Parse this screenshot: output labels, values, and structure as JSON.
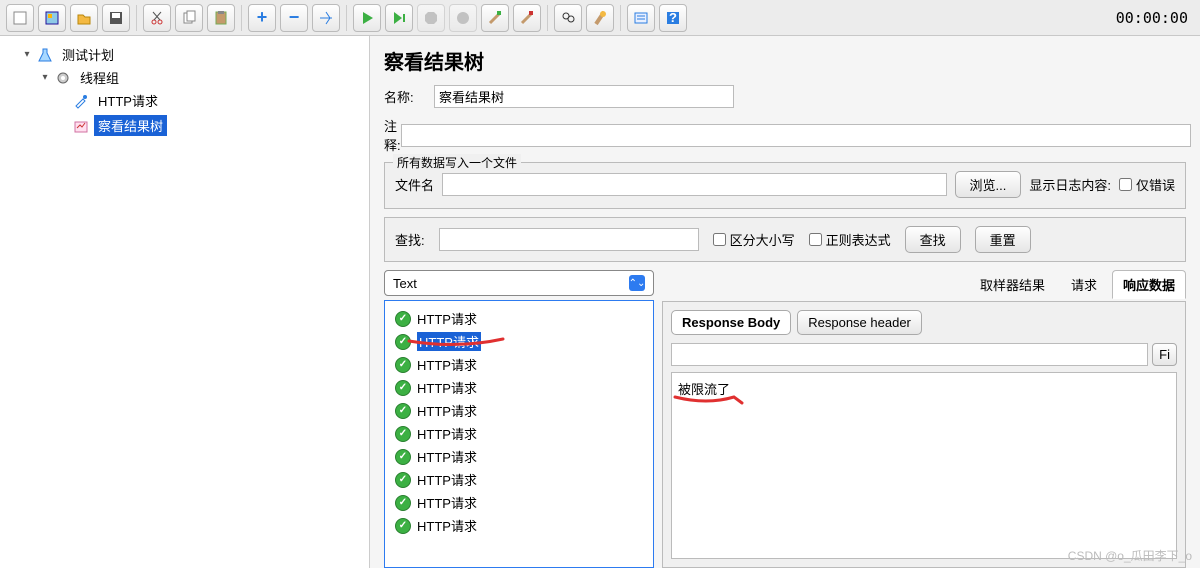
{
  "timer": "00:00:00",
  "tree": {
    "root": "测试计划",
    "group": "线程组",
    "http": "HTTP请求",
    "results": "察看结果树"
  },
  "panel": {
    "title": "察看结果树",
    "name_label": "名称:",
    "name_value": "察看结果树",
    "comment_label": "注释:",
    "file_legend": "所有数据写入一个文件",
    "file_label": "文件名",
    "browse": "浏览...",
    "log_label": "显示日志内容:",
    "only_error": "仅错误"
  },
  "search": {
    "label": "查找:",
    "case": "区分大小写",
    "regex": "正则表达式",
    "find": "查找",
    "reset": "重置"
  },
  "dropdown": "Text",
  "results": [
    {
      "label": "HTTP请求",
      "selected": false
    },
    {
      "label": "HTTP请求",
      "selected": true
    },
    {
      "label": "HTTP请求",
      "selected": false
    },
    {
      "label": "HTTP请求",
      "selected": false
    },
    {
      "label": "HTTP请求",
      "selected": false
    },
    {
      "label": "HTTP请求",
      "selected": false
    },
    {
      "label": "HTTP请求",
      "selected": false
    },
    {
      "label": "HTTP请求",
      "selected": false
    },
    {
      "label": "HTTP请求",
      "selected": false
    },
    {
      "label": "HTTP请求",
      "selected": false
    }
  ],
  "tabs": {
    "sampler": "取样器结果",
    "request": "请求",
    "response": "响应数据"
  },
  "subtabs": {
    "body": "Response Body",
    "header": "Response header"
  },
  "filter_btn": "Fi",
  "response_text": "被限流了",
  "watermark": "CSDN @o_瓜田李下_o"
}
